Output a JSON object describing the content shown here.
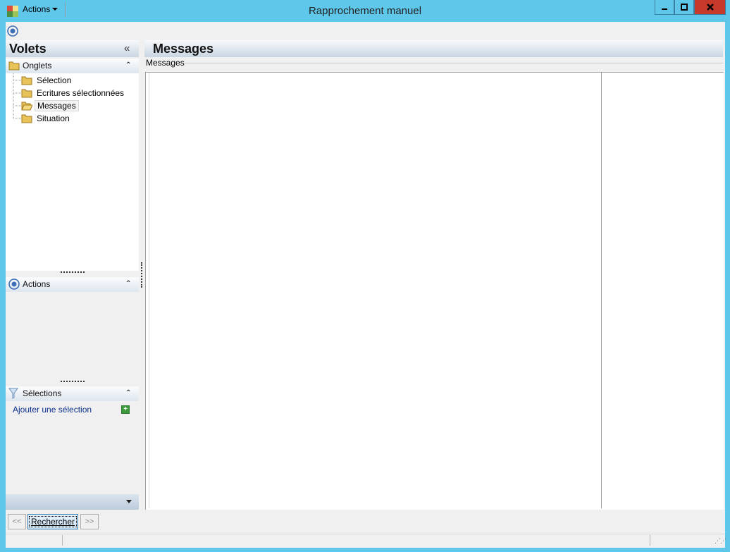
{
  "window": {
    "title": "Rapprochement manuel"
  },
  "toolbar": {
    "actions_label": "Actions"
  },
  "left_panel": {
    "title": "Volets",
    "tabs_section": {
      "label": "Onglets",
      "items": [
        {
          "label": "Sélection",
          "selected": false
        },
        {
          "label": "Ecritures sélectionnées",
          "selected": false
        },
        {
          "label": "Messages",
          "selected": true
        },
        {
          "label": "Situation",
          "selected": false
        }
      ]
    },
    "actions_section": {
      "label": "Actions"
    },
    "selections_section": {
      "label": "Sélections",
      "add_link": "Ajouter une sélection"
    }
  },
  "main": {
    "title": "Messages",
    "group_label": "Messages"
  },
  "nav": {
    "prev": "<<",
    "search": "Rechercher",
    "next": ">>"
  },
  "colors": {
    "titlebar": "#5fc7ea",
    "close": "#c7392b",
    "link": "#0b2f8a"
  }
}
